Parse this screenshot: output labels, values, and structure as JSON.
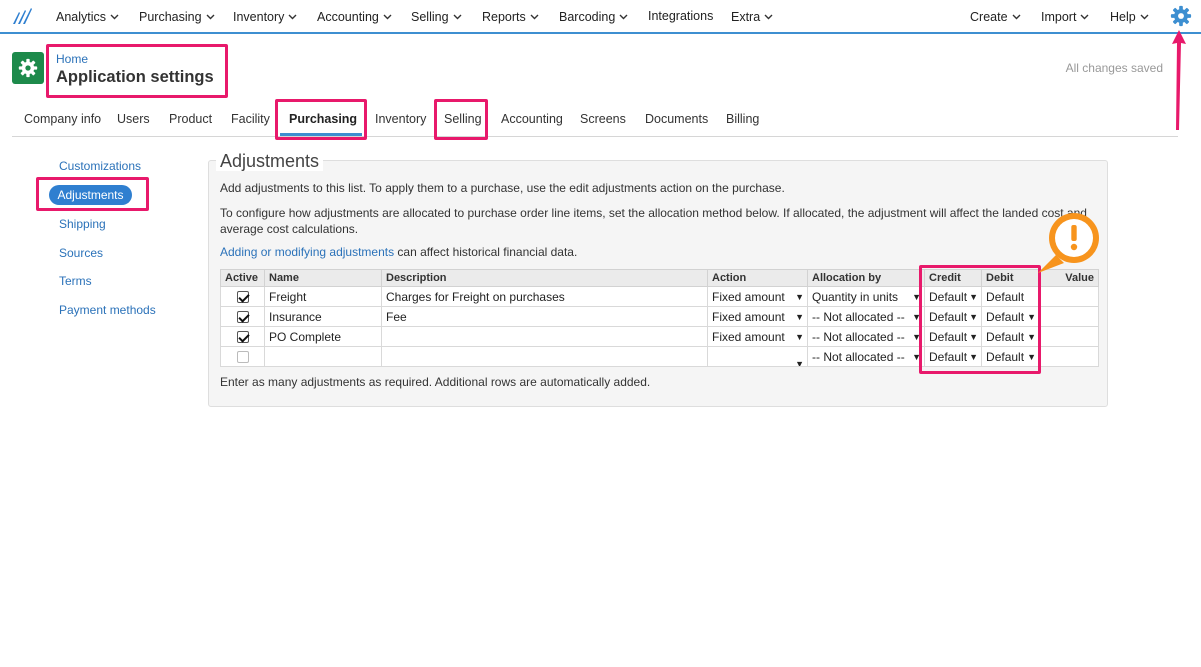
{
  "nav": {
    "items": [
      {
        "label": "Analytics",
        "dropdown": true
      },
      {
        "label": "Purchasing",
        "dropdown": true
      },
      {
        "label": "Inventory",
        "dropdown": true
      },
      {
        "label": "Accounting",
        "dropdown": true
      },
      {
        "label": "Selling",
        "dropdown": true
      },
      {
        "label": "Reports",
        "dropdown": true
      },
      {
        "label": "Barcoding",
        "dropdown": true
      },
      {
        "label": "Integrations",
        "dropdown": false
      },
      {
        "label": "Extra",
        "dropdown": true
      }
    ],
    "right_items": [
      {
        "label": "Create",
        "dropdown": true
      },
      {
        "label": "Import",
        "dropdown": true
      },
      {
        "label": "Help",
        "dropdown": true
      }
    ],
    "settings_icon": "gear-icon",
    "accent_color": "#3d8fd1"
  },
  "header": {
    "breadcrumb": "Home",
    "title": "Application settings",
    "status": "All changes saved",
    "app_icon": "gear-icon",
    "app_icon_color": "#1d8a4b"
  },
  "tabs": [
    {
      "label": "Company info"
    },
    {
      "label": "Users"
    },
    {
      "label": "Product"
    },
    {
      "label": "Facility"
    },
    {
      "label": "Purchasing",
      "active": true
    },
    {
      "label": "Inventory"
    },
    {
      "label": "Selling"
    },
    {
      "label": "Accounting"
    },
    {
      "label": "Screens"
    },
    {
      "label": "Documents"
    },
    {
      "label": "Billing"
    }
  ],
  "sidebar": {
    "items": [
      {
        "label": "Customizations"
      },
      {
        "label": "Adjustments",
        "active": true
      },
      {
        "label": "Shipping"
      },
      {
        "label": "Sources"
      },
      {
        "label": "Terms"
      },
      {
        "label": "Payment methods"
      }
    ]
  },
  "adjustments": {
    "title": "Adjustments",
    "intro": "Add adjustments to this list. To apply them to a purchase, use the edit adjustments action on the purchase.",
    "config_line1": "To configure how adjustments are allocated to purchase order line items, set the allocation method below. If allocated, the adjustment will affect the landed cost and",
    "config_line2": "average cost calculations.",
    "warning_link": "Adding or modifying adjustments",
    "warning_rest": " can affect historical financial data.",
    "columns": [
      "Active",
      "Name",
      "Description",
      "Action",
      "Allocation by",
      "Credit",
      "Debit",
      "Value"
    ],
    "rows": [
      {
        "active": true,
        "name": "Freight",
        "description": "Charges for Freight on purchases",
        "action": "Fixed amount",
        "allocation": "Quantity in units",
        "credit": "Default",
        "debit": "Default",
        "debit_dropdown": false,
        "value": ""
      },
      {
        "active": true,
        "name": "Insurance",
        "description": "Fee",
        "action": "Fixed amount",
        "allocation": "-- Not allocated --",
        "credit": "Default",
        "debit": "Default",
        "debit_dropdown": true,
        "value": ""
      },
      {
        "active": true,
        "name": "PO Complete",
        "description": "",
        "action": "Fixed amount",
        "allocation": "-- Not allocated --",
        "credit": "Default",
        "debit": "Default",
        "debit_dropdown": true,
        "value": ""
      },
      {
        "active": false,
        "name": "",
        "description": "",
        "action": "",
        "allocation": "-- Not allocated --",
        "credit": "Default",
        "debit": "Default",
        "debit_dropdown": true,
        "value": ""
      }
    ],
    "footer": "Enter as many adjustments as required. Additional rows are automatically added."
  },
  "annotations": {
    "highlight_color": "#e8196b",
    "warning_color": "#f7941d",
    "warning_icon": "exclamation-icon"
  }
}
